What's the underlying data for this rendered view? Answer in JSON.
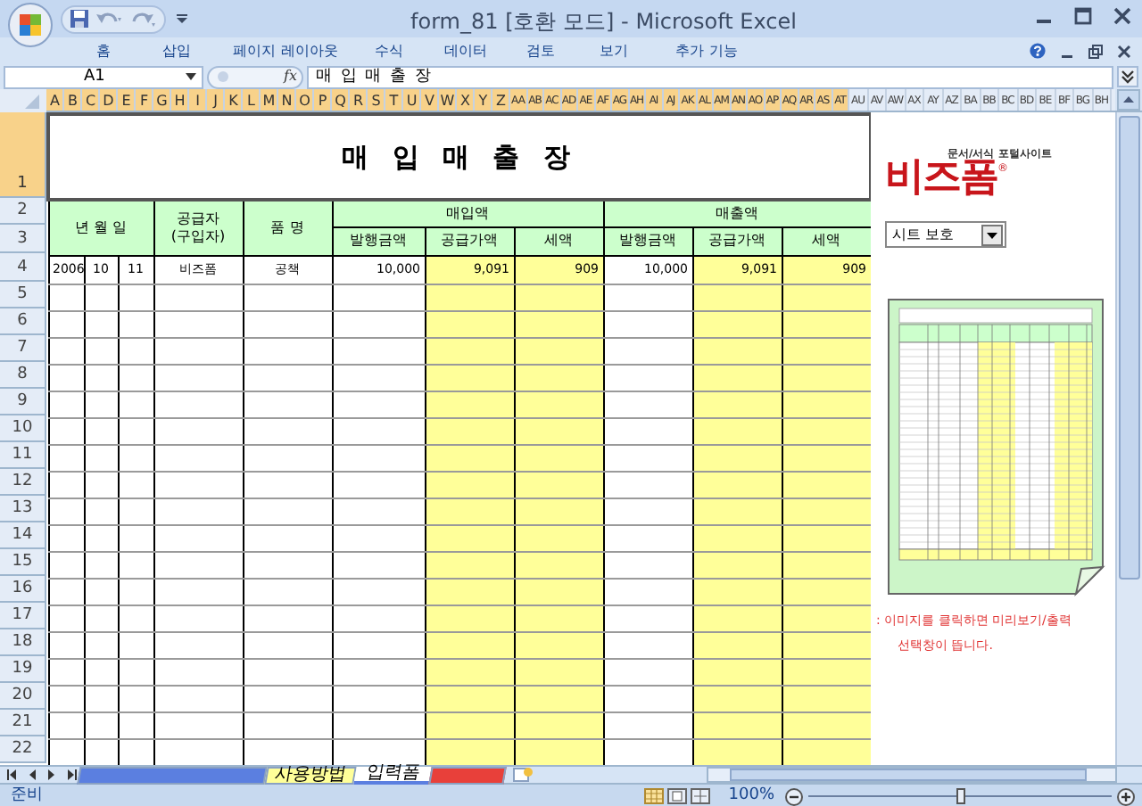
{
  "window": {
    "title": "form_81  [호환 모드] - Microsoft Excel"
  },
  "ribbon_tabs": [
    "홈",
    "삽입",
    "페이지 레이아웃",
    "수식",
    "데이터",
    "검토",
    "보기",
    "추가 기능"
  ],
  "formula_bar": {
    "name_box": "A1",
    "fx": "fx",
    "formula": "매 입 매 출 장"
  },
  "column_headers": [
    {
      "label": "A",
      "selected": true
    },
    {
      "label": "B",
      "selected": true
    },
    {
      "label": "C",
      "selected": true
    },
    {
      "label": "D",
      "selected": true
    },
    {
      "label": "E",
      "selected": true
    },
    {
      "label": "F",
      "selected": true
    },
    {
      "label": "G",
      "selected": true
    },
    {
      "label": "H",
      "selected": true
    },
    {
      "label": "I",
      "selected": true
    },
    {
      "label": "J",
      "selected": true
    },
    {
      "label": "K",
      "selected": true
    },
    {
      "label": "L",
      "selected": true
    },
    {
      "label": "M",
      "selected": true
    },
    {
      "label": "N",
      "selected": true
    },
    {
      "label": "O",
      "selected": true
    },
    {
      "label": "P",
      "selected": true
    },
    {
      "label": "Q",
      "selected": true
    },
    {
      "label": "R",
      "selected": true
    },
    {
      "label": "S",
      "selected": true
    },
    {
      "label": "T",
      "selected": true
    },
    {
      "label": "U",
      "selected": true
    },
    {
      "label": "V",
      "selected": true
    },
    {
      "label": "W",
      "selected": true
    },
    {
      "label": "X",
      "selected": true
    },
    {
      "label": "Y",
      "selected": true
    },
    {
      "label": "Z",
      "selected": true
    },
    {
      "label": "AA",
      "selected": true
    },
    {
      "label": "AB",
      "selected": true
    },
    {
      "label": "AC",
      "selected": true
    },
    {
      "label": "AD",
      "selected": true
    },
    {
      "label": "AE",
      "selected": true
    },
    {
      "label": "AF",
      "selected": true
    },
    {
      "label": "AG",
      "selected": true
    },
    {
      "label": "AH",
      "selected": true
    },
    {
      "label": "AI",
      "selected": true
    },
    {
      "label": "AJ",
      "selected": true
    },
    {
      "label": "AK",
      "selected": true
    },
    {
      "label": "AL",
      "selected": true
    },
    {
      "label": "AM",
      "selected": true
    },
    {
      "label": "AN",
      "selected": true
    },
    {
      "label": "AO",
      "selected": true
    },
    {
      "label": "AP",
      "selected": true
    },
    {
      "label": "AQ",
      "selected": true
    },
    {
      "label": "AR",
      "selected": true
    },
    {
      "label": "AS",
      "selected": true
    },
    {
      "label": "AT",
      "selected": true
    },
    {
      "label": "AU",
      "selected": false
    },
    {
      "label": "AV",
      "selected": false
    },
    {
      "label": "AW",
      "selected": false
    },
    {
      "label": "AX",
      "selected": false
    },
    {
      "label": "AY",
      "selected": false
    },
    {
      "label": "AZ",
      "selected": false
    },
    {
      "label": "BA",
      "selected": false
    },
    {
      "label": "BB",
      "selected": false
    },
    {
      "label": "BC",
      "selected": false
    },
    {
      "label": "BD",
      "selected": false
    },
    {
      "label": "BE",
      "selected": false
    },
    {
      "label": "BF",
      "selected": false
    },
    {
      "label": "BG",
      "selected": false
    },
    {
      "label": "BH",
      "selected": false
    }
  ],
  "row_headers": [
    {
      "label": "1",
      "selected": true
    },
    {
      "label": "2",
      "selected": false
    },
    {
      "label": "3",
      "selected": false
    },
    {
      "label": "4",
      "selected": false
    },
    {
      "label": "5",
      "selected": false
    },
    {
      "label": "6",
      "selected": false
    },
    {
      "label": "7",
      "selected": false
    },
    {
      "label": "8",
      "selected": false
    },
    {
      "label": "9",
      "selected": false
    },
    {
      "label": "10",
      "selected": false
    },
    {
      "label": "11",
      "selected": false
    },
    {
      "label": "12",
      "selected": false
    },
    {
      "label": "13",
      "selected": false
    },
    {
      "label": "14",
      "selected": false
    },
    {
      "label": "15",
      "selected": false
    },
    {
      "label": "16",
      "selected": false
    },
    {
      "label": "17",
      "selected": false
    },
    {
      "label": "18",
      "selected": false
    },
    {
      "label": "19",
      "selected": false
    },
    {
      "label": "20",
      "selected": false
    },
    {
      "label": "21",
      "selected": false
    },
    {
      "label": "22",
      "selected": false
    }
  ],
  "sheet": {
    "title": "매 입 매 출 장",
    "header_date": "년 월 일",
    "header_supplier": "공급자\n(구입자)",
    "header_item": "품 명",
    "header_purchase": "매입액",
    "header_sales": "매출액",
    "sub_headers": [
      "발행금액",
      "공급가액",
      "세액",
      "발행금액",
      "공급가액",
      "세액"
    ],
    "rows": [
      [
        "2006",
        "10",
        "11",
        "비즈폼",
        "공책",
        "10,000",
        "9,091",
        "909",
        "10,000",
        "9,091",
        "909"
      ]
    ]
  },
  "side_panel": {
    "logo": "비즈폼",
    "logo_mark": "®",
    "tagline": "문서/서식 포털사이트",
    "dropdown": "시트 보호",
    "note": [
      ": 이미지를 클릭하면 미리보기/출력",
      "선택창이 뜹니다."
    ]
  },
  "sheet_tabs": [
    {
      "color": "#5b7fe0",
      "selected": false
    },
    {
      "label": "사용방법",
      "color": "#ffff99",
      "selected": false
    },
    {
      "label": "입력폼",
      "color": "#ffffff",
      "selected": true
    },
    {
      "color": "#e8403a",
      "selected": false
    }
  ],
  "status_bar": {
    "text": "준비",
    "zoom": "100%",
    "level": 0.5
  }
}
